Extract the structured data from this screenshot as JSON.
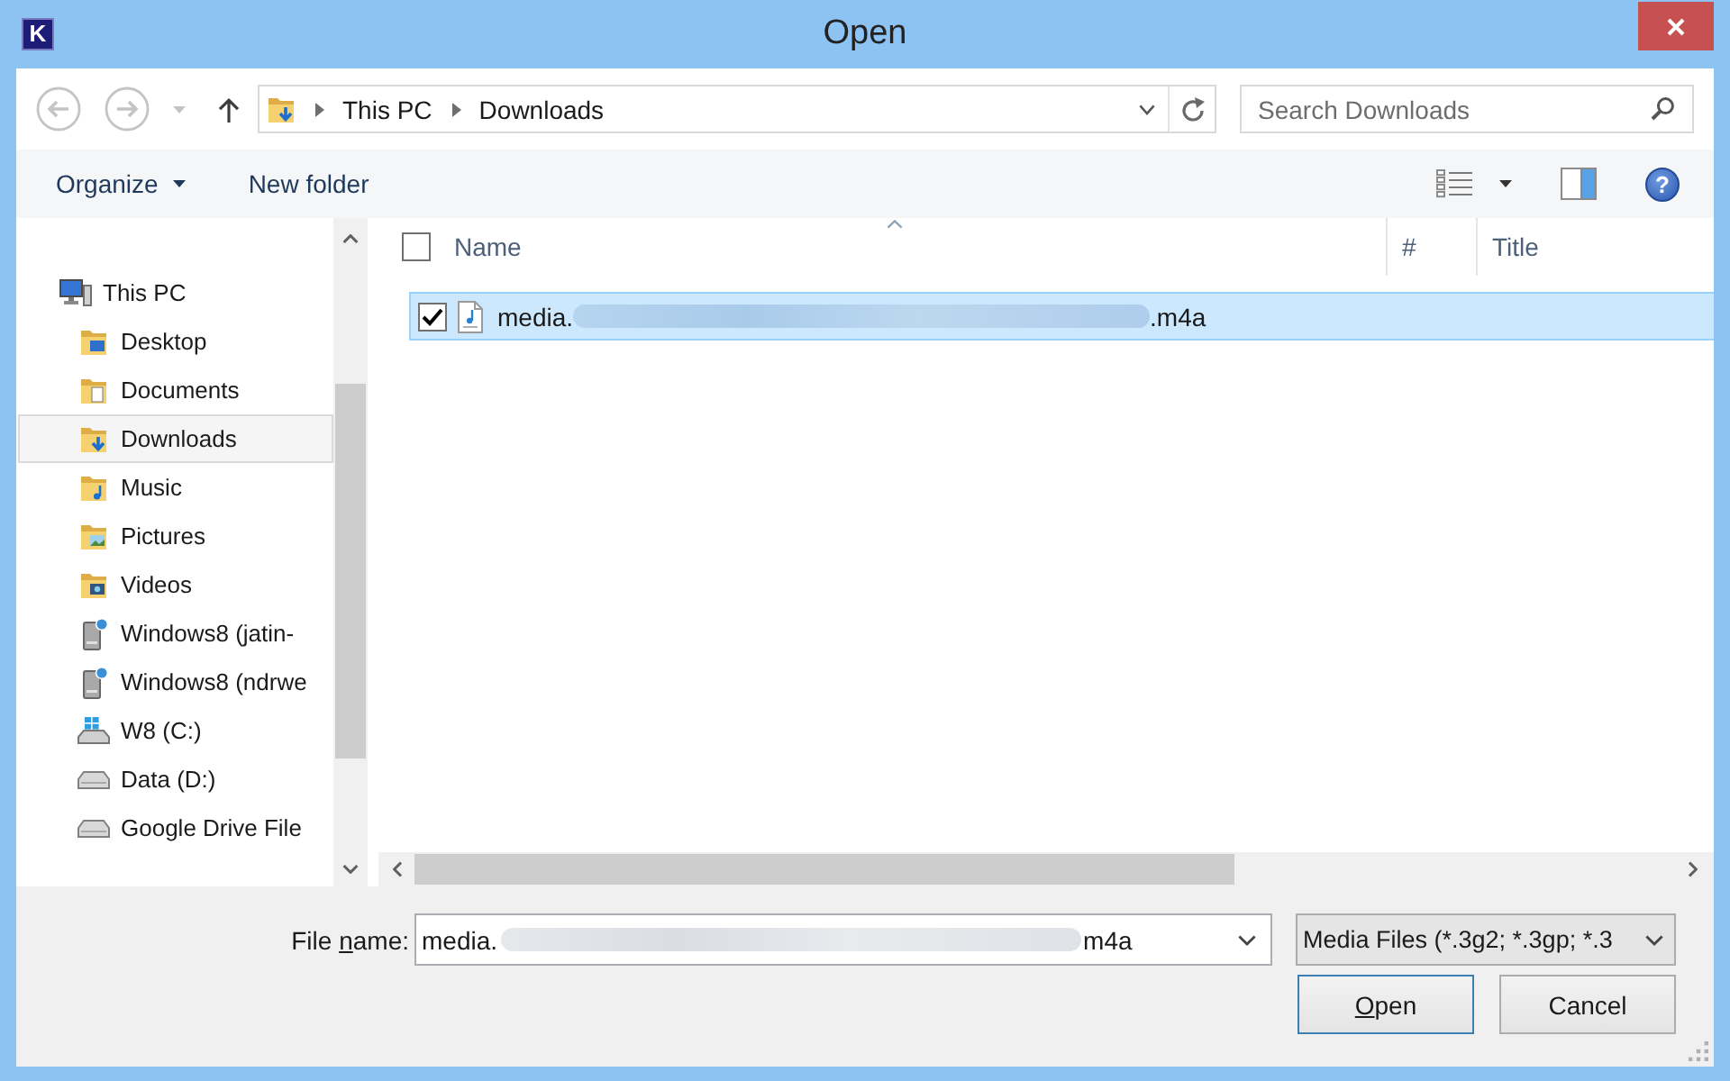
{
  "window": {
    "icon_letter": "K",
    "title": "Open"
  },
  "navigation": {
    "back": {
      "disabled": true
    },
    "forward": {
      "disabled": true
    },
    "recent": {
      "disabled": true
    },
    "up": {
      "disabled": false
    }
  },
  "address_bar": {
    "path": [
      {
        "label": "This PC"
      },
      {
        "label": "Downloads"
      }
    ]
  },
  "search": {
    "placeholder": "Search Downloads"
  },
  "toolbar": {
    "organize": "Organize",
    "new_folder": "New folder",
    "help": "?"
  },
  "sidebar": {
    "items": [
      {
        "label": "This PC",
        "kind": "computer",
        "selected": false,
        "children": [
          {
            "label": "Desktop",
            "kind": "desktop",
            "selected": false
          },
          {
            "label": "Documents",
            "kind": "documents",
            "selected": false
          },
          {
            "label": "Downloads",
            "kind": "downloads",
            "selected": true
          },
          {
            "label": "Music",
            "kind": "music",
            "selected": false
          },
          {
            "label": "Pictures",
            "kind": "pictures",
            "selected": false
          },
          {
            "label": "Videos",
            "kind": "videos",
            "selected": false
          },
          {
            "label": "Windows8 (jatin-",
            "kind": "network_drive",
            "selected": false
          },
          {
            "label": "Windows8 (ndrwe",
            "kind": "network_drive",
            "selected": false
          },
          {
            "label": "W8 (C:)",
            "kind": "system_drive",
            "selected": false
          },
          {
            "label": "Data (D:)",
            "kind": "drive",
            "selected": false
          },
          {
            "label": "Google Drive File",
            "kind": "drive",
            "selected": false
          }
        ]
      }
    ]
  },
  "file_list": {
    "select_all": {
      "checked": false
    },
    "columns": [
      {
        "label": "Name",
        "sorted": true
      },
      {
        "label": "#",
        "sorted": false
      },
      {
        "label": "Title",
        "sorted": false
      }
    ],
    "rows": [
      {
        "name_start": "media.",
        "name_end": ".m4a",
        "checked": true,
        "selected": true
      }
    ]
  },
  "footer": {
    "file_name": {
      "label_before": "File ",
      "access_key": "n",
      "label_rest": "ame:",
      "value_start": "media.",
      "value_end": "m4a"
    },
    "file_type": {
      "value": "Media Files (*.3g2; *.3gp; *.3"
    },
    "buttons": [
      {
        "access_key": "O",
        "label_rest": "pen",
        "default": true
      },
      {
        "label": "Cancel",
        "default": false
      }
    ]
  }
}
